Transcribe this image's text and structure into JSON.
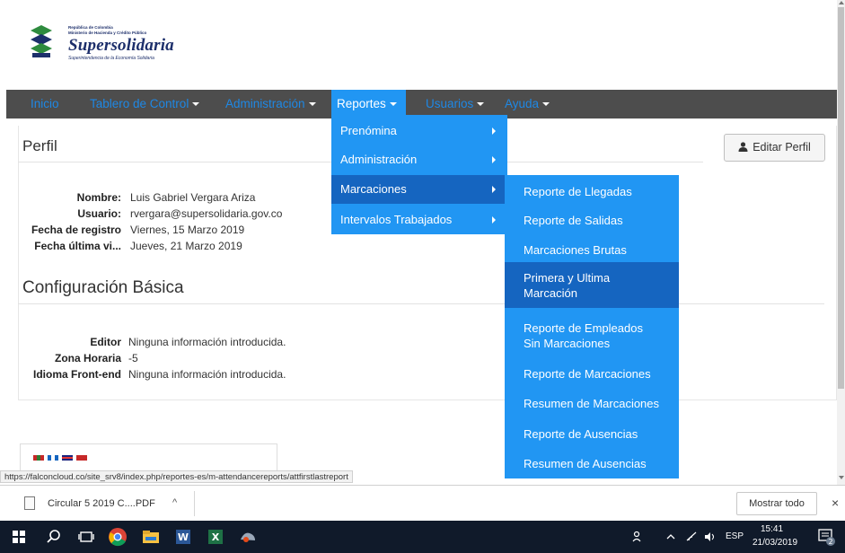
{
  "brand": {
    "small_line1": "República de Colombia",
    "small_line2": "Ministerio de Hacienda y Crédito Público",
    "title": "Supersolidaria",
    "subtitle": "Superintendencia de la Economía Solidaria"
  },
  "nav": [
    {
      "label": "Inicio"
    },
    {
      "label": "Tablero de Control"
    },
    {
      "label": "Administración"
    },
    {
      "label": "Reportes"
    },
    {
      "label": "Usuarios"
    },
    {
      "label": "Ayuda"
    }
  ],
  "profile": {
    "heading": "Perfil",
    "edit_label": "Editar Perfil",
    "fields": [
      {
        "label": "Nombre:",
        "value": "Luis Gabriel Vergara Ariza"
      },
      {
        "label": "Usuario:",
        "value": "rvergara@supersolidaria.gov.co"
      },
      {
        "label": "Fecha de registro",
        "value": "Viernes, 15 Marzo 2019"
      },
      {
        "label": "Fecha última vi...",
        "value": "Jueves, 21 Marzo 2019"
      }
    ]
  },
  "config": {
    "heading": "Configuración Básica",
    "fields": [
      {
        "label": "Editor",
        "value": "Ninguna información introducida."
      },
      {
        "label": "Zona Horaria",
        "value": "-5"
      },
      {
        "label": "Idioma Front-end",
        "value": "Ninguna información introducida."
      }
    ]
  },
  "reports_menu": [
    {
      "label": "Prenómina"
    },
    {
      "label": "Administración"
    },
    {
      "label": "Marcaciones"
    },
    {
      "label": "Intervalos Trabajados"
    }
  ],
  "marcaciones_submenu": [
    {
      "label": "Reporte de Llegadas"
    },
    {
      "label": "Reporte de Salidas"
    },
    {
      "label": "Marcaciones Brutas"
    },
    {
      "label": "Primera y Ultima Marcación"
    },
    {
      "label": "Reporte de Empleados Sin Marcaciones"
    },
    {
      "label": "Reporte de Marcaciones"
    },
    {
      "label": "Resumen de Marcaciones"
    },
    {
      "label": "Reporte de Ausencias"
    },
    {
      "label": "Resumen de Ausencias"
    }
  ],
  "status_url": "https://falconcloud.co/site_srv8/index.php/reportes-es/m-attendancereports/attfirstlastreport",
  "download": {
    "file_name": "Circular 5 2019 C....PDF",
    "caret": "^",
    "show_all": "Mostrar todo",
    "close": "×"
  },
  "taskbar": {
    "lang": "ESP",
    "time": "15:41",
    "date": "21/03/2019",
    "notifications": "2"
  },
  "colors": {
    "nav_bg": "#4d4d4d",
    "accent": "#2196f3",
    "accent_dark": "#1565c0",
    "brand_blue": "#1d2f6b"
  }
}
